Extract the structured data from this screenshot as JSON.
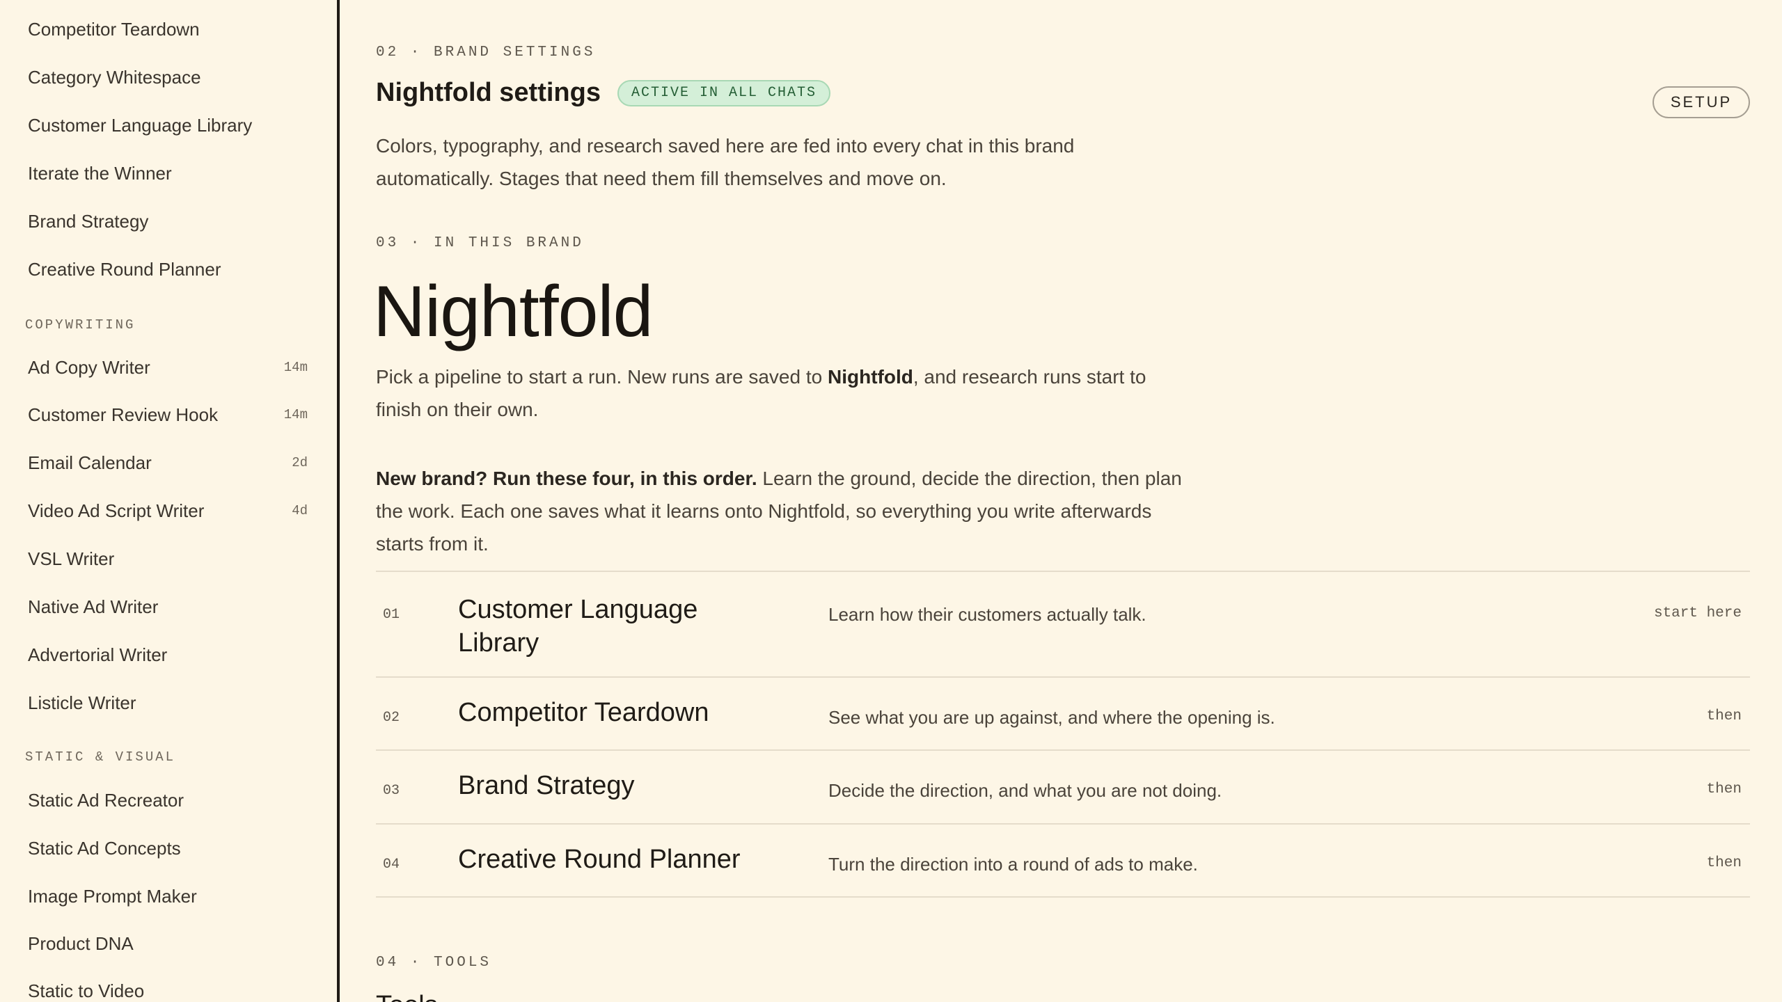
{
  "sidebar": {
    "top_items": [
      {
        "label": "Competitor Teardown"
      },
      {
        "label": "Category Whitespace"
      },
      {
        "label": "Customer Language Library"
      },
      {
        "label": "Iterate the Winner"
      },
      {
        "label": "Brand Strategy"
      },
      {
        "label": "Creative Round Planner"
      }
    ],
    "sections": [
      {
        "label": "COPYWRITING",
        "items": [
          {
            "label": "Ad Copy Writer",
            "meta": "14m"
          },
          {
            "label": "Customer Review Hook",
            "meta": "14m"
          },
          {
            "label": "Email Calendar",
            "meta": "2d"
          },
          {
            "label": "Video Ad Script Writer",
            "meta": "4d"
          },
          {
            "label": "VSL Writer",
            "meta": ""
          },
          {
            "label": "Native Ad Writer",
            "meta": ""
          },
          {
            "label": "Advertorial Writer",
            "meta": ""
          },
          {
            "label": "Listicle Writer",
            "meta": ""
          }
        ]
      },
      {
        "label": "STATIC & VISUAL",
        "items": [
          {
            "label": "Static Ad Recreator",
            "meta": ""
          },
          {
            "label": "Static Ad Concepts",
            "meta": ""
          },
          {
            "label": "Image Prompt Maker",
            "meta": ""
          },
          {
            "label": "Product DNA",
            "meta": ""
          },
          {
            "label": "Static to Video",
            "meta": ""
          }
        ]
      }
    ]
  },
  "settings": {
    "eyebrow": "02 · BRAND SETTINGS",
    "title": "Nightfold settings",
    "badge": "ACTIVE IN ALL CHATS",
    "setup_label": "SETUP",
    "desc_line1": "Colors, typography, and research saved here are fed into every chat in this brand",
    "desc_line2": "automatically. Stages that need them fill themselves and move on."
  },
  "brand": {
    "eyebrow": "03 · IN THIS BRAND",
    "name": "Nightfold",
    "intro_a": "Pick a pipeline to start a run. New runs are saved to ",
    "intro_bold": "Nightfold",
    "intro_b": ", and research runs start to",
    "intro_line2": "finish on their own.",
    "order_bold": "New brand? Run these four, in this order.",
    "order_a": " Learn the ground, decide the direction, then plan",
    "order_line2": "the work. Each one saves what it learns onto Nightfold, so everything you write afterwards",
    "order_line3": "starts from it."
  },
  "pipeline": [
    {
      "num": "01",
      "name": "Customer Language Library",
      "desc": "Learn how their customers actually talk.",
      "tag": "start here"
    },
    {
      "num": "02",
      "name": "Competitor Teardown",
      "desc": "See what you are up against, and where the opening is.",
      "tag": "then"
    },
    {
      "num": "03",
      "name": "Brand Strategy",
      "desc": "Decide the direction, and what you are not doing.",
      "tag": "then"
    },
    {
      "num": "04",
      "name": "Creative Round Planner",
      "desc": "Turn the direction into a round of ads to make.",
      "tag": "then"
    }
  ],
  "tools": {
    "eyebrow": "04 · TOOLS",
    "heading": "Tools"
  }
}
